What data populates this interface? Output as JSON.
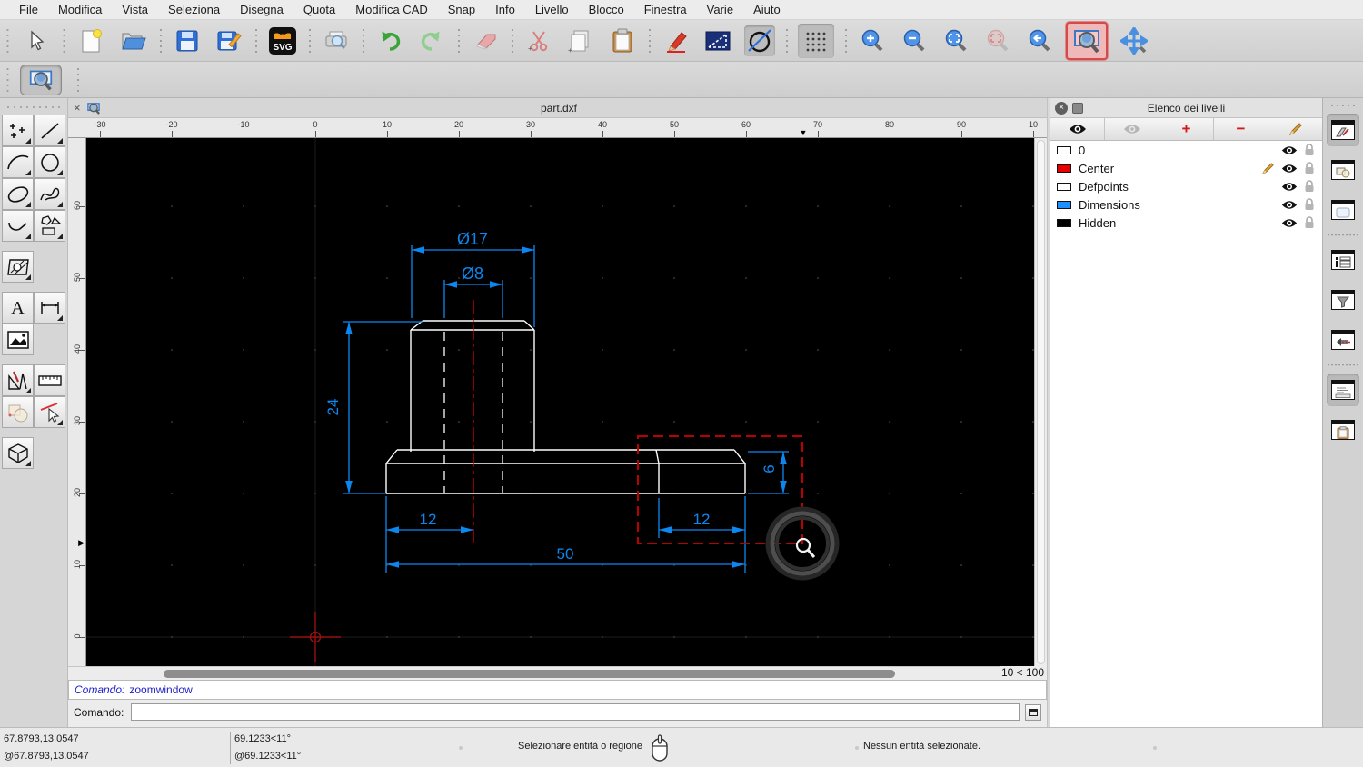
{
  "menu": {
    "items": [
      "File",
      "Modifica",
      "Vista",
      "Seleziona",
      "Disegna",
      "Quota",
      "Modifica CAD",
      "Snap",
      "Info",
      "Livello",
      "Blocco",
      "Finestra",
      "Varie",
      "Aiuto"
    ]
  },
  "toolbar": {
    "svg_label": "SVG"
  },
  "tab": {
    "title": "part.dxf"
  },
  "rulers": {
    "horizontal": [
      "-30",
      "-20",
      "-10",
      "0",
      "10",
      "20",
      "30",
      "40",
      "50",
      "60",
      "70",
      "80",
      "90",
      "10"
    ],
    "vertical": [
      "60",
      "50",
      "40",
      "30",
      "20",
      "10",
      "0"
    ]
  },
  "drawing": {
    "dim_diameter_outer": "Ø17",
    "dim_diameter_inner": "Ø8",
    "dim_height": "24",
    "dim_offset_left": "12",
    "dim_offset_right": "12",
    "dim_total_width": "50",
    "dim_plate_thickness": "6"
  },
  "zoom_indicator": "10 < 100",
  "command": {
    "history_label": "Comando:",
    "history_value": "zoomwindow",
    "prompt_label": "Comando:",
    "input_value": ""
  },
  "status": {
    "abs_coord": "67.8793,13.0547",
    "rel_coord": "@67.8793,13.0547",
    "abs_polar": "69.1233<11°",
    "rel_polar": "@69.1233<11°",
    "hint": "Selezionare entità o regione",
    "selection_info": "Nessun entità selezionate."
  },
  "layers_panel": {
    "title": "Elenco dei livelli",
    "rows": [
      {
        "name": "0",
        "color": "#ffffff"
      },
      {
        "name": "Center",
        "color": "#e80000"
      },
      {
        "name": "Defpoints",
        "color": "#ffffff"
      },
      {
        "name": "Dimensions",
        "color": "#1e8fff"
      },
      {
        "name": "Hidden",
        "color": "#000000"
      }
    ]
  },
  "icons": {
    "close": "×",
    "plus": "+",
    "minus": "−",
    "text_tool": "A"
  },
  "colors": {
    "dimension_blue": "#0d87f0",
    "outline_white": "#ffffff",
    "centerline_red": "#dd0000",
    "selection_red": "#bb0000",
    "active_tool_red": "#d24a4a",
    "canvas_black": "#000000"
  }
}
